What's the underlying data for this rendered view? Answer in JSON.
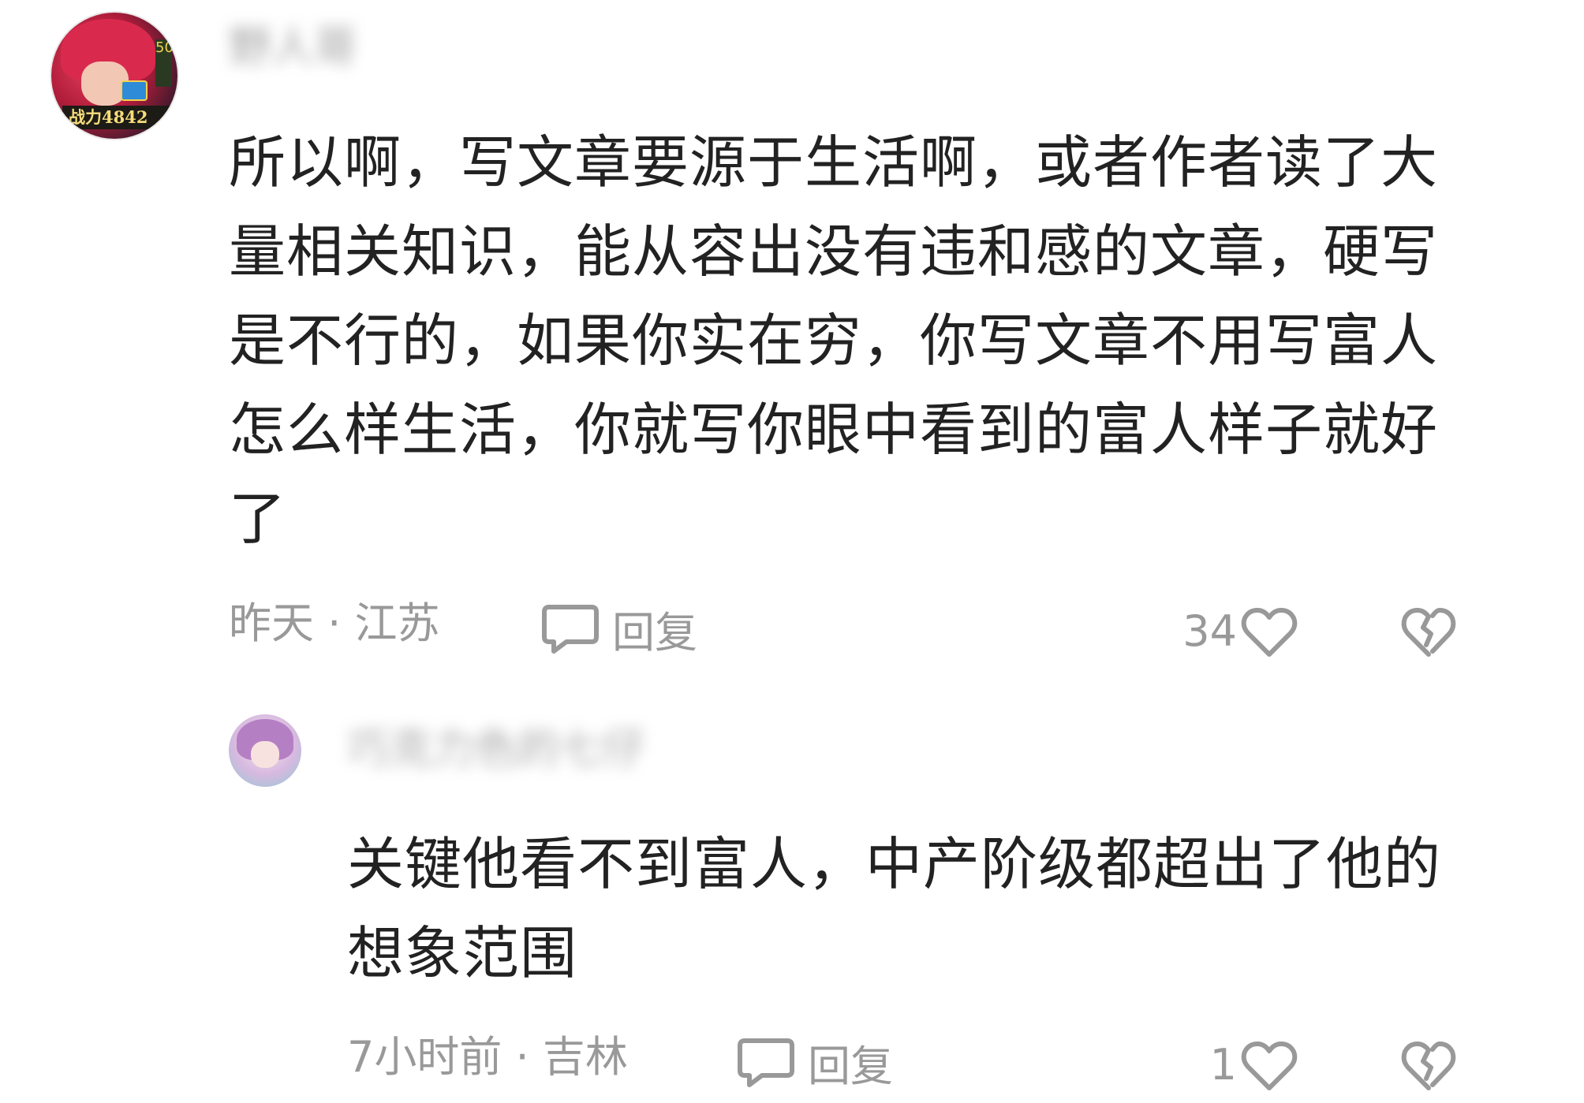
{
  "comments": [
    {
      "username": "野人哥",
      "avatar_badge": "战力4842",
      "avatar_level": "50",
      "text": "所以啊，写文章要源于生活啊，或者作者读了大量相关知识，能从容出没有违和感的文章，硬写是不行的，如果你实在穷，你写文章不用写富人怎么样生活，你就写你眼中看到的富人样子就好了",
      "time": "昨天",
      "location": "江苏",
      "meta": "昨天 · 江苏",
      "reply_label": "回复",
      "likes": "34",
      "icons": {
        "reply": "speech-bubble-icon",
        "like": "heart-icon",
        "dislike": "broken-heart-icon"
      }
    },
    {
      "username": "巧克力色的七仔",
      "text": "关键他看不到富人，中产阶级都超出了他的想象范围",
      "time": "7小时前",
      "location": "吉林",
      "meta": "7小时前 · 吉林",
      "reply_label": "回复",
      "likes": "1",
      "icons": {
        "reply": "speech-bubble-icon",
        "like": "heart-icon",
        "dislike": "broken-heart-icon"
      }
    }
  ],
  "colors": {
    "text": "#222222",
    "meta": "#999999",
    "background": "#ffffff"
  }
}
